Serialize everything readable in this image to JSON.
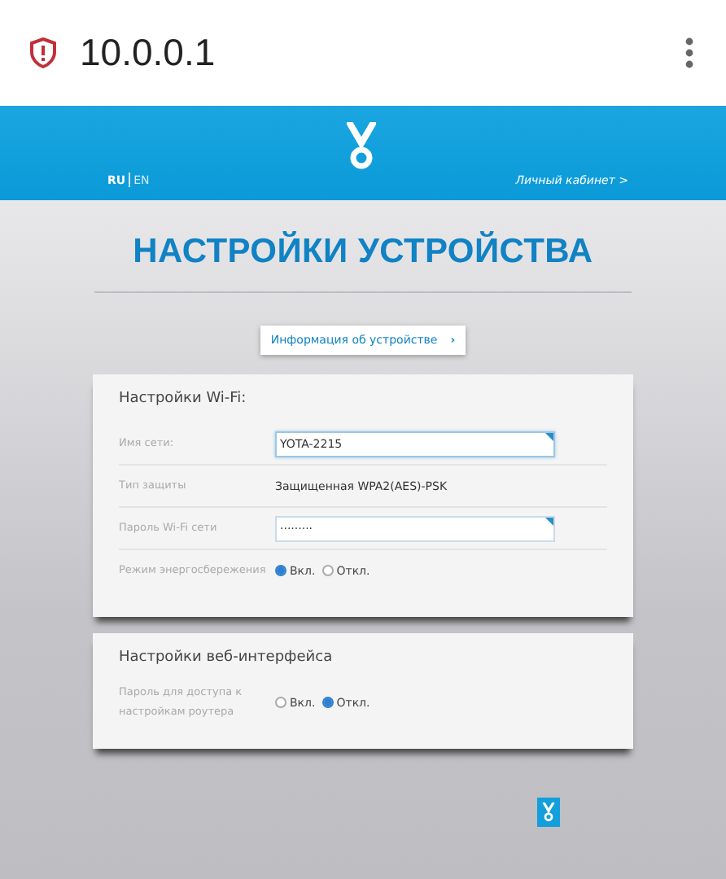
{
  "browser": {
    "url": "10.0.0.1"
  },
  "header": {
    "languages": [
      {
        "label": "RU",
        "selected": true
      },
      {
        "label": "EN",
        "selected": false
      }
    ],
    "account_link": "Личный кабинет >"
  },
  "title": "НАСТРОЙКИ УСТРОЙСТВА",
  "info_button": {
    "label": "Информация об устройстве",
    "arrow": "›"
  },
  "sections": [
    {
      "title": "Настройки Wi-Fi:",
      "rows": [
        {
          "kind": "input",
          "label": "Имя сети:",
          "value": "YOTA-2215"
        },
        {
          "kind": "text",
          "label": "Тип защиты",
          "value": "Защищенная WPA2(AES)-PSK"
        },
        {
          "kind": "input",
          "label": "Пароль Wi-Fi сети",
          "value": "·········"
        },
        {
          "kind": "radio",
          "label": "Режим энергосбережения",
          "options": [
            {
              "label": "Вкл.",
              "selected": true
            },
            {
              "label": "Откл.",
              "selected": false
            }
          ]
        }
      ]
    },
    {
      "title": "Настройки веб-интерфейса",
      "rows": [
        {
          "kind": "radio",
          "label": "Пароль для доступа к настройкам роутера",
          "options": [
            {
              "label": "Вкл.",
              "selected": false
            },
            {
              "label": "Откл.",
              "selected": true
            }
          ]
        }
      ]
    }
  ]
}
